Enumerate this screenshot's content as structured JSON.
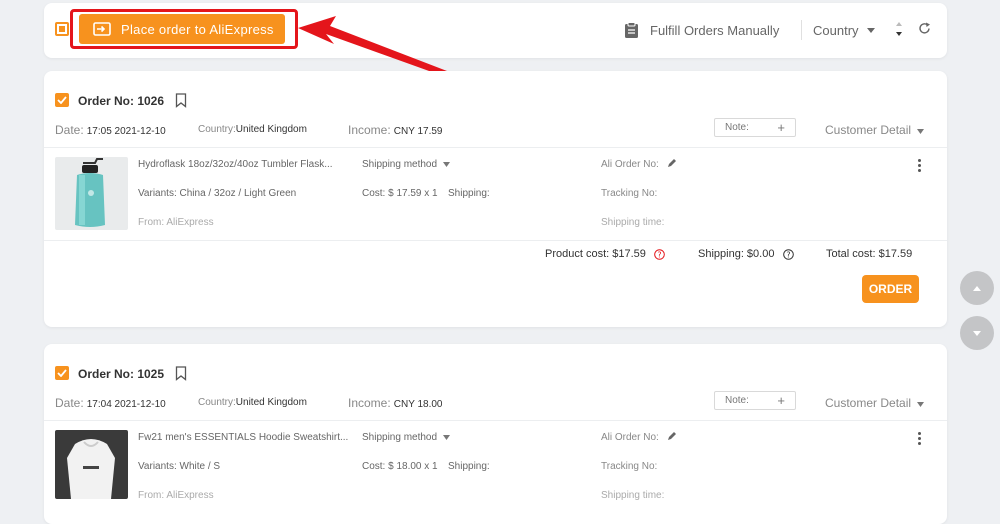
{
  "toolbar": {
    "place_order_label": "Place order to AliExpress",
    "fulfill_manually_label": "Fulfill Orders Manually",
    "country_filter_label": "Country"
  },
  "orders": [
    {
      "order_no": "Order No: 1026",
      "date_label": "Date:",
      "date_value": "17:05 2021-12-10",
      "country_label": "Country:",
      "country_value": "United Kingdom",
      "income_label": "Income:",
      "income_value": "CNY 17.59",
      "note_label": "Note:",
      "customer_detail_label": "Customer Detail",
      "product": {
        "title": "Hydroflask 18oz/32oz/40oz Tumbler Flask...",
        "variants": "Variants: China / 32oz / Light Green",
        "from": "From: AliExpress",
        "shipping_method": "Shipping method",
        "cost": "Cost: $ 17.59 x 1",
        "shipping": "Shipping:",
        "ali_order_no": "Ali Order No:",
        "tracking_no": "Tracking No:",
        "shipping_time": "Shipping time:"
      },
      "summary": {
        "product_cost": "Product cost: $17.59",
        "shipping": "Shipping: $0.00",
        "total_cost": "Total cost: $17.59"
      },
      "order_button_label": "ORDER"
    },
    {
      "order_no": "Order No: 1025",
      "date_label": "Date:",
      "date_value": "17:04 2021-12-10",
      "country_label": "Country:",
      "country_value": "United Kingdom",
      "income_label": "Income:",
      "income_value": "CNY 18.00",
      "note_label": "Note:",
      "customer_detail_label": "Customer Detail",
      "product": {
        "title": "Fw21 men's ESSENTIALS Hoodie Sweatshirt...",
        "variants": "Variants: White / S",
        "from": "From: AliExpress",
        "shipping_method": "Shipping method",
        "cost": "Cost: $ 18.00 x 1",
        "shipping": "Shipping:",
        "ali_order_no": "Ali Order No:",
        "tracking_no": "Tracking No:",
        "shipping_time": "Shipping time:"
      }
    }
  ],
  "colors": {
    "accent": "#f7921e",
    "highlight": "#e4151b",
    "background": "#eef0f3"
  }
}
